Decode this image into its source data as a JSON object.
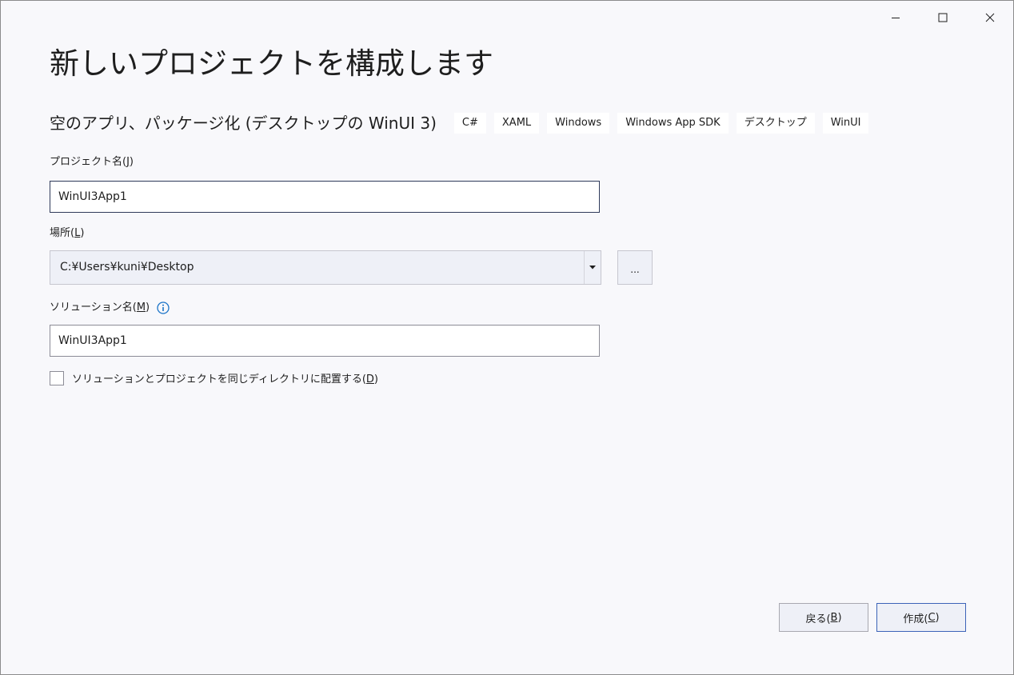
{
  "window": {
    "title": "新しいプロジェクトを構成します",
    "caption_buttons": [
      "minimize-icon",
      "maximize-icon",
      "close-icon"
    ]
  },
  "template": {
    "name": "空のアプリ、パッケージ化 (デスクトップの WinUI 3)",
    "tags": [
      "C#",
      "XAML",
      "Windows",
      "Windows App SDK",
      "デスクトップ",
      "WinUI"
    ]
  },
  "project_name": {
    "label": "プロジェクト名(",
    "accesskey": "J",
    "label_end": ")",
    "value": "WinUI3App1"
  },
  "location": {
    "label": "場所(",
    "accesskey": "L",
    "label_end": ")",
    "value": "C:¥Users¥kuni¥Desktop",
    "browse_label": "..."
  },
  "solution_name": {
    "label": "ソリューション名(",
    "accesskey": "M",
    "label_end": ")",
    "value": "WinUI3App1",
    "info_icon": "info-icon"
  },
  "same_directory": {
    "label": "ソリューションとプロジェクトを同じディレクトリに配置する(",
    "accesskey": "D",
    "label_end": ")",
    "checked": false
  },
  "buttons": {
    "back": {
      "label": "戻る(",
      "accesskey": "B",
      "label_end": ")"
    },
    "create": {
      "label": "作成(",
      "accesskey": "C",
      "label_end": ")"
    }
  },
  "colors": {
    "background": "#f8f8fb",
    "accent": "#3c63b8",
    "info": "#1a73c7"
  }
}
